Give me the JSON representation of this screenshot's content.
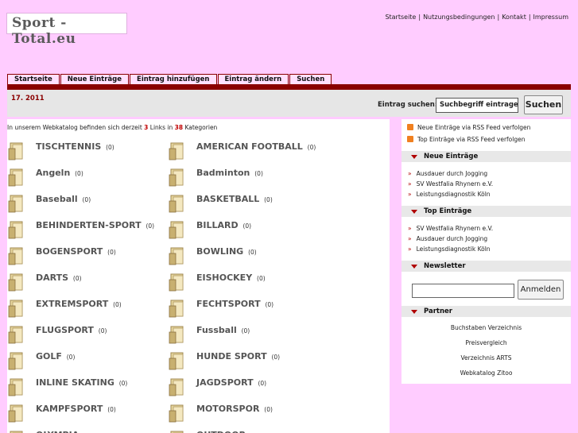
{
  "header": {
    "logo_text": "Sport - Total.eu",
    "top_links": [
      "Startseite",
      "Nutzungsbedingungen",
      "Kontakt",
      "Impressum"
    ]
  },
  "nav": {
    "tabs": [
      "Startseite",
      "Neue Einträge",
      "Eintrag hinzufügen",
      "Eintrag ändern",
      "Suchen"
    ]
  },
  "infobar": {
    "date": "17. 2011",
    "search_label": "Eintrag suchen:",
    "search_value": "Suchbegriff eintragen",
    "search_button": "Suchen"
  },
  "main": {
    "intro_prefix": "In unserem Webkatalog befinden sich derzeit",
    "links_count": "3",
    "intro_middle": "Links in",
    "categories_count": "38",
    "intro_suffix": "Kategorien",
    "categories": [
      {
        "name": "TISCHTENNIS",
        "count": "(0)"
      },
      {
        "name": "AMERICAN FOOTBALL",
        "count": "(0)"
      },
      {
        "name": "Angeln",
        "count": "(0)"
      },
      {
        "name": "Badminton",
        "count": "(0)"
      },
      {
        "name": "Baseball",
        "count": "(0)"
      },
      {
        "name": "BASKETBALL",
        "count": "(0)"
      },
      {
        "name": "BEHINDERTEN-SPORT",
        "count": "(0)"
      },
      {
        "name": "BILLARD",
        "count": "(0)"
      },
      {
        "name": "BOGENSPORT",
        "count": "(0)"
      },
      {
        "name": "BOWLING",
        "count": "(0)"
      },
      {
        "name": "DARTS",
        "count": "(0)"
      },
      {
        "name": "EISHOCKEY",
        "count": "(0)"
      },
      {
        "name": "EXTREMSPORT",
        "count": "(0)"
      },
      {
        "name": "FECHTSPORT",
        "count": "(0)"
      },
      {
        "name": "FLUGSPORT",
        "count": "(0)"
      },
      {
        "name": "Fussball",
        "count": "(0)"
      },
      {
        "name": "GOLF",
        "count": "(0)"
      },
      {
        "name": "HUNDE SPORT",
        "count": "(0)"
      },
      {
        "name": "INLINE SKATING",
        "count": "(0)"
      },
      {
        "name": "JAGDSPORT",
        "count": "(0)"
      },
      {
        "name": "KAMPFSPORT",
        "count": "(0)"
      },
      {
        "name": "MOTORSPOR",
        "count": "(0)"
      },
      {
        "name": "OLYMPIA",
        "count": ""
      },
      {
        "name": "OUTDOOR",
        "count": ""
      }
    ]
  },
  "sidebar": {
    "rss_new": "Neue Einträge via RSS Feed verfolgen",
    "rss_top": "Top Einträge via RSS Feed verfolgen",
    "new_title": "Neue Einträge",
    "new_items": [
      "Ausdauer durch Jogging",
      "SV Westfalia Rhynern e.V.",
      "Leistungsdiagnostik Köln"
    ],
    "top_title": "Top Einträge",
    "top_items": [
      "SV Westfalia Rhynern e.V.",
      "Ausdauer durch Jogging",
      "Leistungsdiagnostik Köln"
    ],
    "newsletter_title": "Newsletter",
    "newsletter_button": "Anmelden",
    "partner_title": "Partner",
    "partner_items": [
      "Buchstaben Verzeichnis",
      "Preisvergleich",
      "Verzeichnis ARTS",
      "Webkatalog Zitoo"
    ]
  },
  "colors": {
    "background": "#ffccff",
    "accent": "#8a0000",
    "count_red": "#c00000"
  }
}
